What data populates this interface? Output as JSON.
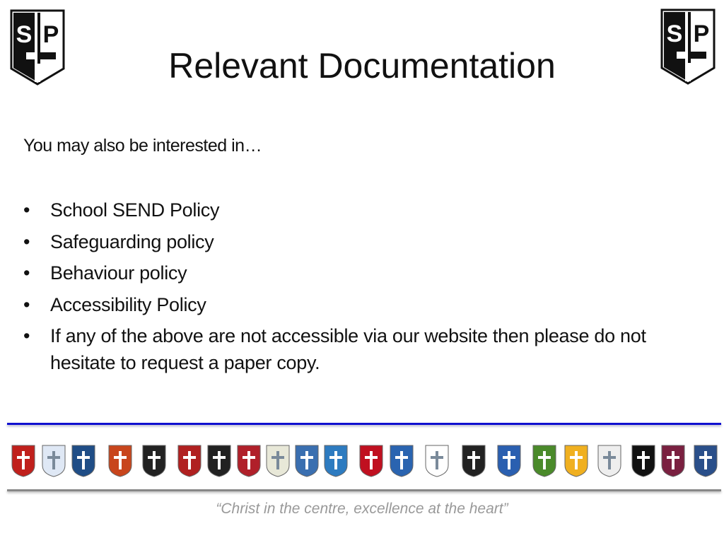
{
  "logo": {
    "text_left": "S",
    "text_right": "P"
  },
  "title": "Relevant Documentation",
  "intro": "You may also be interested in…",
  "bullet_symbol": "•",
  "bullets": [
    "School SEND Policy",
    "Safeguarding policy",
    "Behaviour policy",
    "Accessibility Policy",
    "If any of the above are not accessible via our website then please do not hesitate to request a paper copy."
  ],
  "school_badge_colors": [
    "#c0201c",
    "#dfe8f5",
    "#1f4d86",
    "#c8451c",
    "#222222",
    "#b02020",
    "#222222",
    "#b0202a",
    "#e8e8d8",
    "#3a6fb0",
    "#2d7bc0",
    "#c01020",
    "#2a64b0",
    "#ffffff",
    "#222222",
    "#2a5fb0",
    "#4a8a2a",
    "#f0b020",
    "#eeeeee",
    "#111111",
    "#7a2040",
    "#2a4f8a"
  ],
  "accent_colors": {
    "top_rule": "#1010d0",
    "bottom_rule": "#888888",
    "motto": "#999999"
  },
  "motto": "“Christ in the centre, excellence at the heart”"
}
